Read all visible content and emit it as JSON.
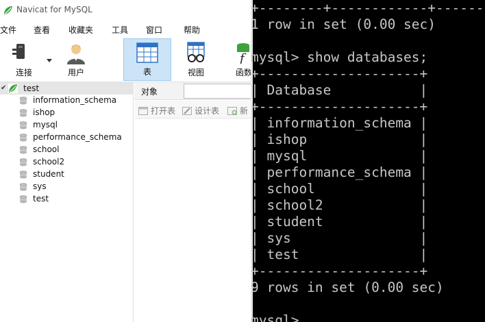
{
  "window": {
    "title": "Navicat for MySQL"
  },
  "menu": {
    "items": [
      "文件",
      "查看",
      "收藏夹",
      "工具",
      "窗口",
      "帮助"
    ]
  },
  "toolbar": {
    "connect_label": "连接",
    "user_label": "用户",
    "table_label": "表",
    "view_label": "视图",
    "function_label": "函数"
  },
  "sidebar": {
    "root": {
      "label": "test"
    },
    "databases": [
      "information_schema",
      "ishop",
      "mysql",
      "performance_schema",
      "school",
      "school2",
      "student",
      "sys",
      "test"
    ]
  },
  "objects": {
    "tab_label": "对象",
    "search_value": "",
    "actions": {
      "open_table": "打开表",
      "design_table": "设计表",
      "new_prefix": "新"
    }
  },
  "console": {
    "lines": [
      "+--------+------------+--------",
      "1 row in set (0.00 sec)",
      "",
      "mysql> show databases;",
      "+--------------------+",
      "| Database           |",
      "+--------------------+",
      "| information_schema |",
      "| ishop              |",
      "| mysql              |",
      "| performance_schema |",
      "| school             |",
      "| school2            |",
      "| student            |",
      "| sys                |",
      "| test               |",
      "+--------------------+",
      "9 rows in set (0.00 sec)",
      "",
      "mysql>"
    ]
  },
  "colors": {
    "console_bg": "#000000",
    "console_text": "#c7c7c7",
    "active_tool_bg": "#cce4f7",
    "tree_selection": "#e5e5e5",
    "navicat_logo": "#3aa43a"
  }
}
